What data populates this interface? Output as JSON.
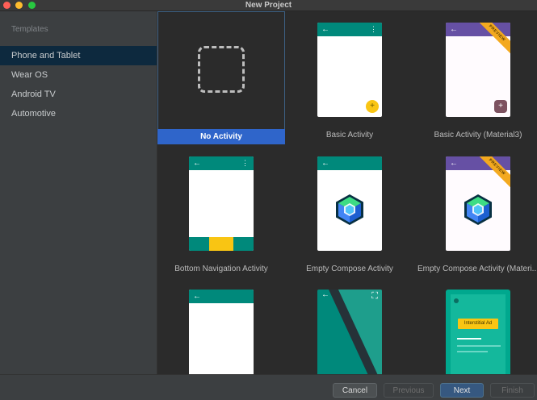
{
  "window": {
    "title": "New Project"
  },
  "sidebar": {
    "heading": "Templates",
    "items": [
      {
        "label": "Phone and Tablet",
        "selected": true
      },
      {
        "label": "Wear OS",
        "selected": false
      },
      {
        "label": "Android TV",
        "selected": false
      },
      {
        "label": "Automotive",
        "selected": false
      }
    ]
  },
  "templates": [
    {
      "label": "No Activity",
      "selected": true
    },
    {
      "label": "Basic Activity"
    },
    {
      "label": "Basic Activity (Material3)",
      "badge": "PREVIEW"
    },
    {
      "label": "Bottom Navigation Activity"
    },
    {
      "label": "Empty Compose Activity"
    },
    {
      "label": "Empty Compose Activity (Materi...",
      "badge": "PREVIEW"
    },
    {
      "label": ""
    },
    {
      "label": ""
    },
    {
      "label": "",
      "ad_text": "Interstitial Ad"
    }
  ],
  "footer": {
    "cancel": "Cancel",
    "previous": "Previous",
    "next": "Next",
    "finish": "Finish"
  },
  "icons": {
    "back": "arrow-left-icon",
    "overflow": "kebab-menu-icon",
    "fab_add": "plus-icon",
    "fullscreen": "fullscreen-icon",
    "compose": "jetpack-compose-logo"
  },
  "colors": {
    "accent": "#2f65ca",
    "sidebar_selected": "#0d293e",
    "teal": "#00897b",
    "purple": "#6650a4",
    "fab": "#f9c513",
    "next_button": "#365880"
  }
}
